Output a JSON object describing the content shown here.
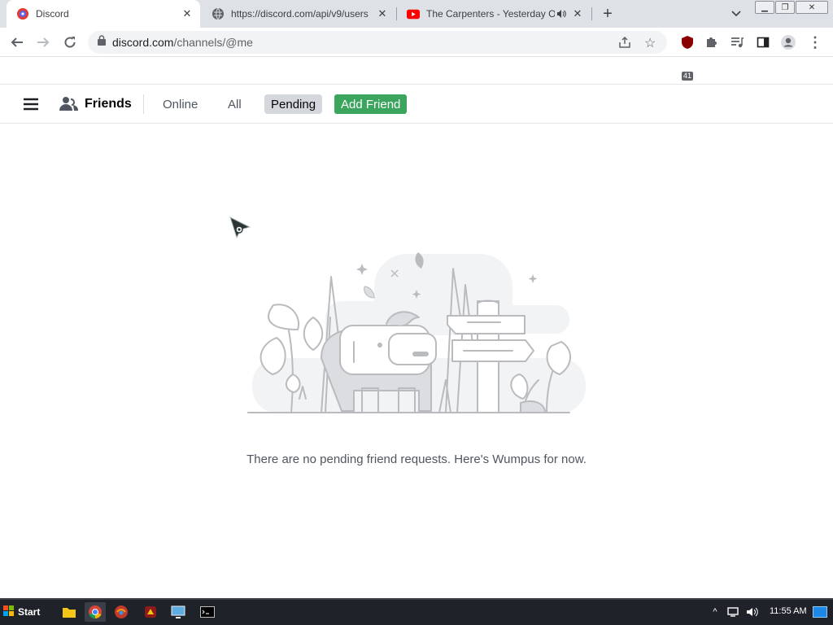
{
  "browser": {
    "tabs": [
      {
        "title": "Discord",
        "active": true,
        "icon": "discord-icon"
      },
      {
        "title": "https://discord.com/api/v9/users",
        "active": false,
        "icon": "globe-icon"
      },
      {
        "title": "The Carpenters - Yesterday O",
        "active": false,
        "icon": "youtube-icon",
        "audio": true
      }
    ],
    "url_host": "discord.com",
    "url_path": "/channels/@me",
    "extension_badge": "41"
  },
  "discord": {
    "header": {
      "title": "Friends",
      "tabs": [
        "Online",
        "All",
        "Pending"
      ],
      "selected_tab": "Pending",
      "add_friend_label": "Add Friend"
    },
    "empty_state_text": "There are no pending friend requests. Here's Wumpus for now."
  },
  "taskbar": {
    "start_label": "Start",
    "clock": "11:55 AM"
  },
  "colors": {
    "add_friend": "#3ba55d",
    "pending_bg": "#d4d7dc",
    "tabstrip": "#dee1e6",
    "taskbar": "#1f2229"
  }
}
